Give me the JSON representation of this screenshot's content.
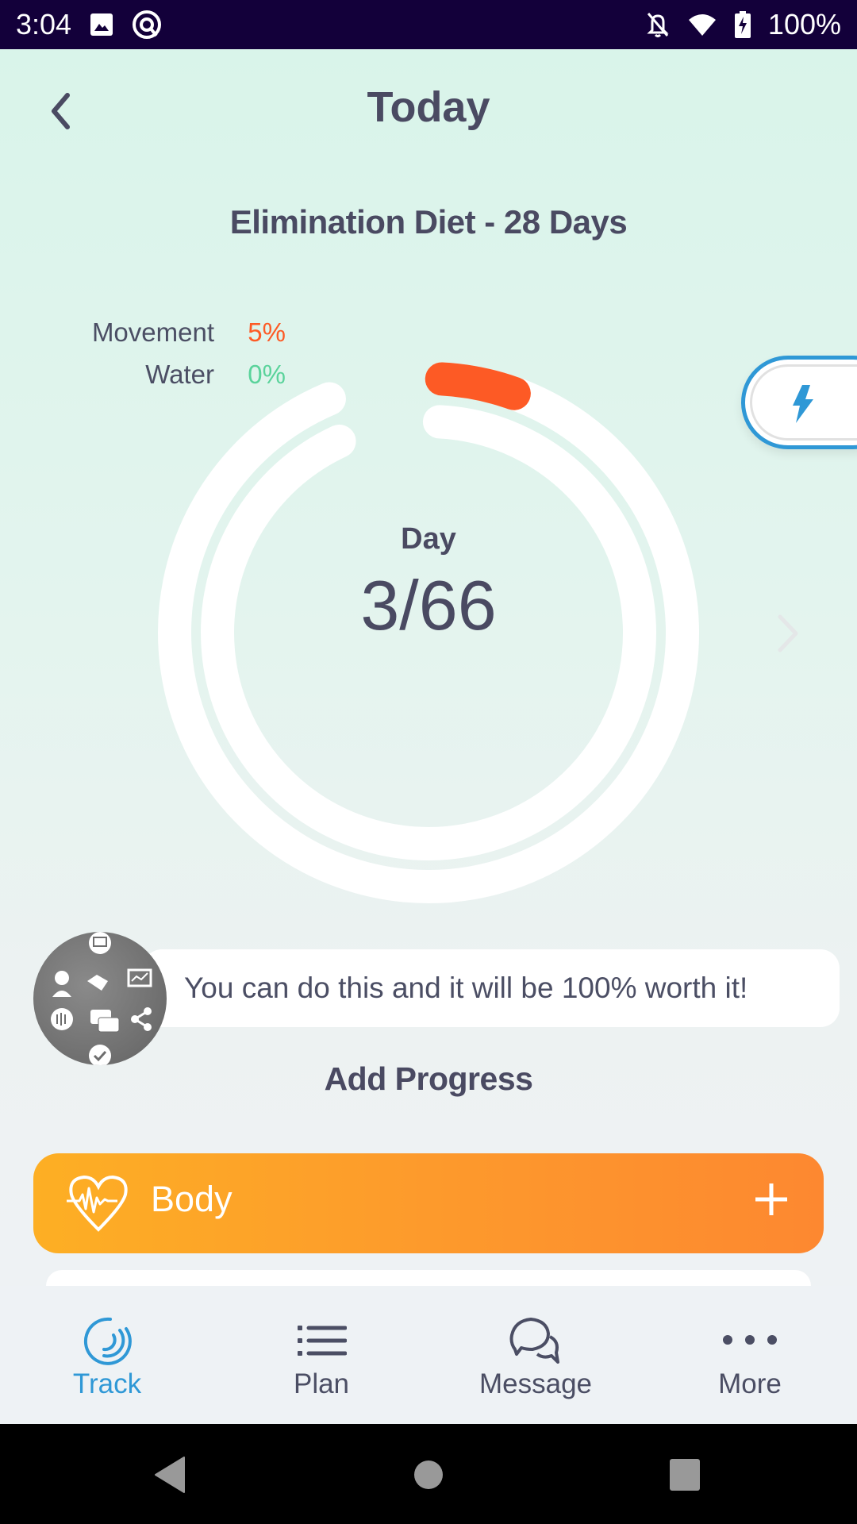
{
  "status_bar": {
    "time": "3:04",
    "left_icons": [
      "image-icon",
      "at-sign-icon"
    ],
    "right_icons": [
      "notifications-off-icon",
      "wifi-icon",
      "battery-charging-icon"
    ],
    "battery": "100%"
  },
  "header": {
    "back_icon": "chevron-left-icon",
    "title": "Today"
  },
  "program": {
    "title": "Elimination Diet - 28 Days"
  },
  "progress_rings": {
    "metrics": [
      {
        "label": "Movement",
        "value_text": "5%",
        "value": 5,
        "color": "#fd5a25"
      },
      {
        "label": "Water",
        "value_text": "0%",
        "value": 0,
        "color": "#5ad39b"
      }
    ],
    "center_label": "Day",
    "center_value": "3/66",
    "track_color": "#ffffff"
  },
  "side_action": {
    "icon": "lightning-bolt-icon",
    "color": "#2f98d6"
  },
  "next_icon": "chevron-right-icon",
  "coach": {
    "avatar": "coach-avatar-icons-collage",
    "message": "You can do this and it will be 100% worth it!"
  },
  "add_progress": {
    "heading": "Add Progress",
    "cards": [
      {
        "label": "Body",
        "icon": "heart-pulse-icon",
        "action_icon": "plus-icon"
      }
    ]
  },
  "tabbar": {
    "active_color": "#2f98d6",
    "tabs": [
      {
        "label": "Track",
        "icon": "track-rings-icon",
        "active": true
      },
      {
        "label": "Plan",
        "icon": "list-icon",
        "active": false
      },
      {
        "label": "Message",
        "icon": "chat-bubbles-icon",
        "active": false
      },
      {
        "label": "More",
        "icon": "more-dots-icon",
        "active": false
      }
    ]
  },
  "system_nav": {
    "buttons": [
      "back-triangle-icon",
      "home-circle-icon",
      "recents-square-icon"
    ]
  }
}
